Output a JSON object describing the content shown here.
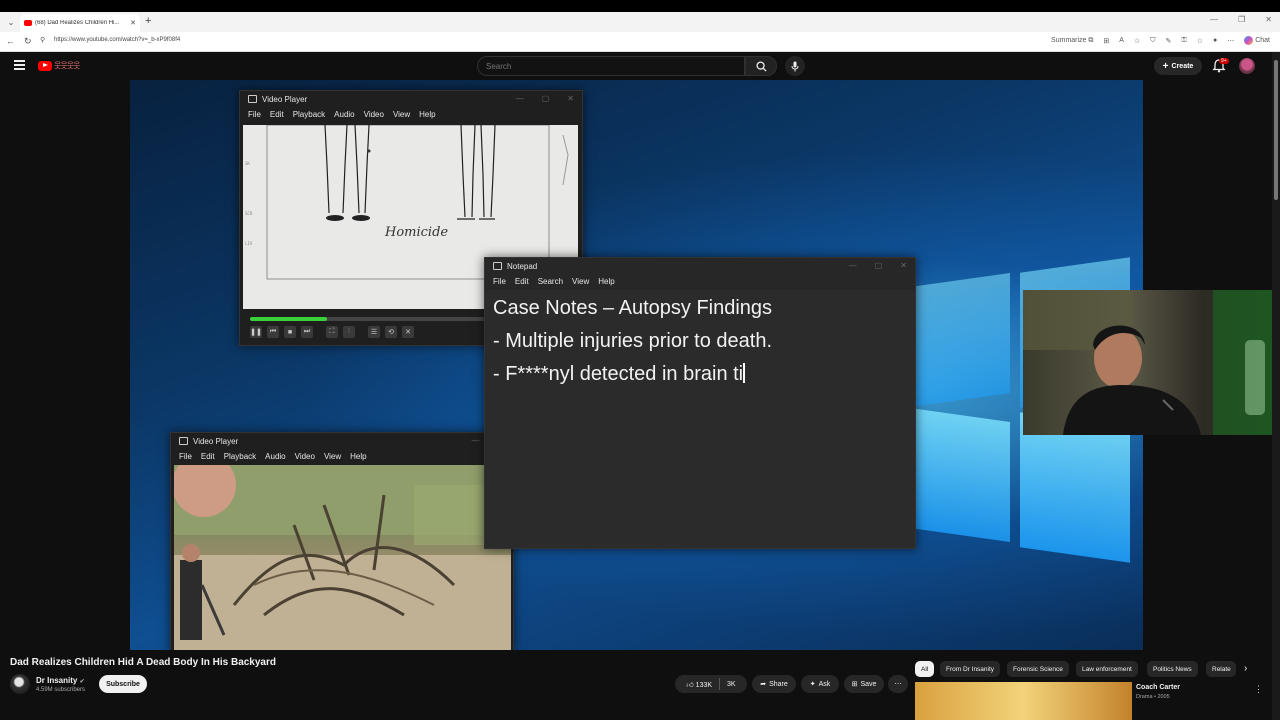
{
  "browser": {
    "tab_title": "(68) Dad Realizes Children Hi...",
    "url": "https://www.youtube.com/watch?v=_b-xP9f08f4",
    "summarize_label": "Summarize",
    "chat_label": "Chat"
  },
  "youtube": {
    "search_placeholder": "Search",
    "create_label": "Create",
    "notification_badge": "9+"
  },
  "video_player_top": {
    "title": "Video Player",
    "menu": [
      "File",
      "Edit",
      "Playback",
      "Audio",
      "Video",
      "View",
      "Help"
    ],
    "frame_text": "Homicide",
    "progress": 0.24
  },
  "video_player_bottom": {
    "title": "Video Player",
    "menu": [
      "File",
      "Edit",
      "Playback",
      "Audio",
      "Video",
      "View",
      "Help"
    ]
  },
  "notepad": {
    "title": "Notepad",
    "menu": [
      "File",
      "Edit",
      "Search",
      "View",
      "Help"
    ],
    "lines": [
      "Case Notes – Autopsy Findings",
      "- Multiple injuries prior to death.",
      "- F****nyl detected in brain ti"
    ]
  },
  "video_info": {
    "title": "Dad Realizes Children Hid A Dead Body In His Backyard",
    "channel": "Dr Insanity",
    "subscribers": "4.59M subscribers",
    "subscribe_label": "Subscribe",
    "likes": "133K",
    "dislikes": "3K",
    "share_label": "Share",
    "ask_label": "Ask",
    "save_label": "Save"
  },
  "chips": [
    "All",
    "From Dr Insanity",
    "Forensic Science",
    "Law enforcement",
    "Politics News",
    "Relate"
  ],
  "recommendation": {
    "title": "Coach Carter",
    "meta": "Drama • 2005"
  },
  "colors": {
    "accent_red": "#ff0000",
    "progress_green": "#39d23a",
    "bg_dark": "#0f0f0f"
  }
}
